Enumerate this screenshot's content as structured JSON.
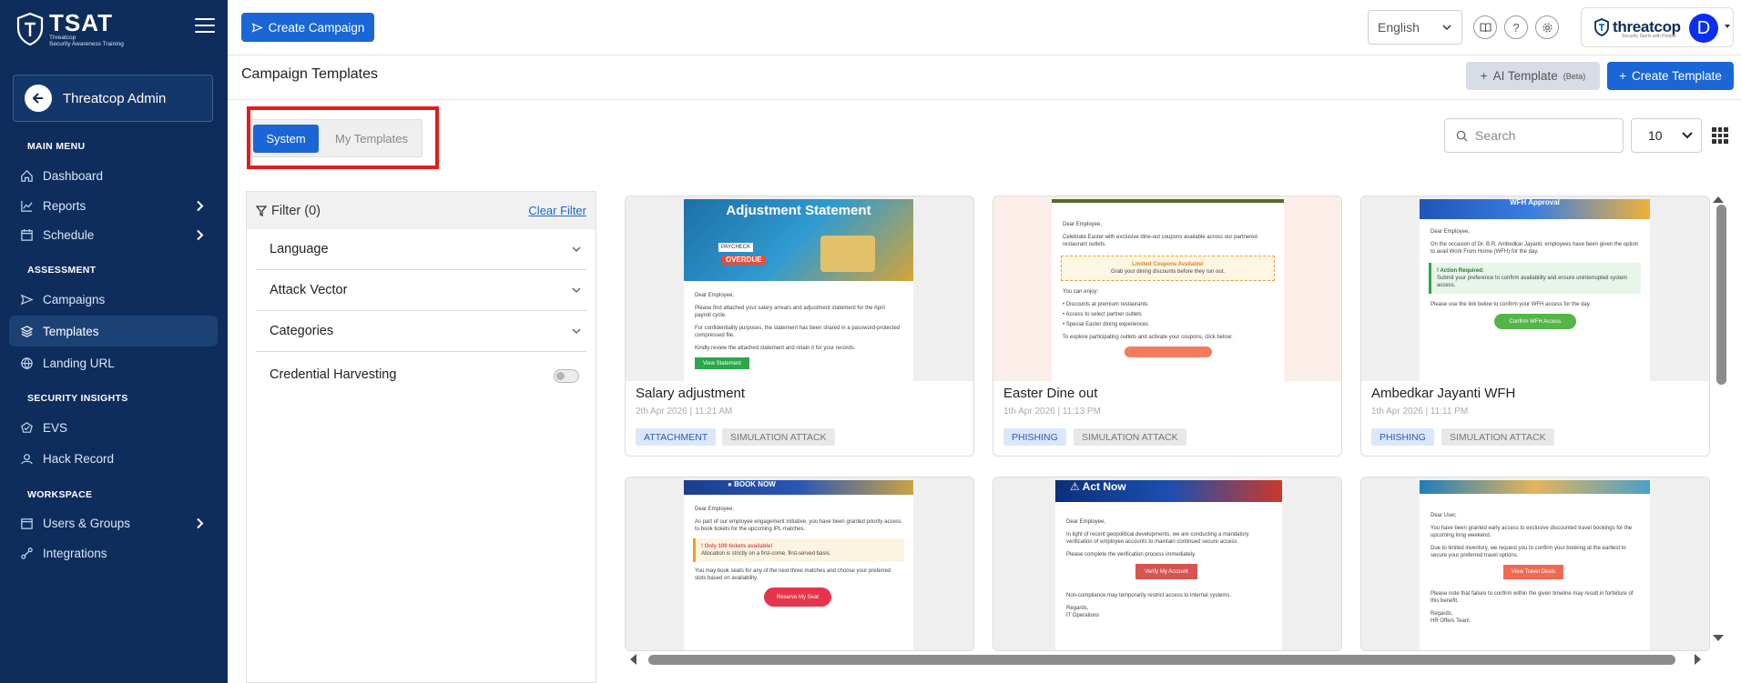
{
  "sidebar": {
    "logo_text": "TSAT",
    "logo_sub1": "Threatcop",
    "logo_sub2": "Security Awareness Training",
    "admin_label": "Threatcop Admin",
    "sections": {
      "main": "MAIN MENU",
      "assessment": "ASSESSMENT",
      "insights": "SECURITY INSIGHTS",
      "workspace": "WORKSPACE"
    },
    "items": {
      "dashboard": "Dashboard",
      "reports": "Reports",
      "schedule": "Schedule",
      "campaigns": "Campaigns",
      "templates": "Templates",
      "landing_url": "Landing URL",
      "evs": "EVS",
      "hack_record": "Hack Record",
      "users_groups": "Users & Groups",
      "integrations": "Integrations"
    },
    "active_item": "Templates"
  },
  "topbar": {
    "create_campaign": "Create Campaign",
    "language": "English",
    "brand_name": "threatcop",
    "brand_tagline": "Security Starts with People",
    "avatar_letter": "D"
  },
  "page": {
    "title": "Campaign Templates",
    "ai_template": "AI Template",
    "ai_badge": "(Beta)",
    "create_template": "Create Template"
  },
  "tabs": {
    "system": "System",
    "my_templates": "My Templates",
    "selected": "System"
  },
  "search": {
    "placeholder": "Search"
  },
  "per_page": "10",
  "filter": {
    "title": "Filter (0)",
    "clear": "Clear Filter",
    "language": "Language",
    "attack_vector": "Attack Vector",
    "categories": "Categories",
    "credential_harvesting": "Credential Harvesting"
  },
  "cards": [
    {
      "title": "Salary adjustment",
      "date": "2th Apr 2026 | 11:21 AM",
      "tag1": "ATTACHMENT",
      "tag2": "SIMULATION ATTACK",
      "banner": "Adjustment Statement",
      "banner_note1": "PAYCHECK",
      "banner_note2": "OVERDUE",
      "greeting": "Dear Employee,",
      "line1": "Please find attached your salary arrears and adjustment statement for the April payroll cycle.",
      "line2": "For confidentiality purposes, the statement has been shared in a password-protected compressed file.",
      "line3": "Kindly review the attached statement and retain it for your records.",
      "cta": "View Statement"
    },
    {
      "title": "Easter Dine out",
      "date": "1th Apr 2026 | 11:13 PM",
      "tag1": "PHISHING",
      "tag2": "SIMULATION ATTACK",
      "greeting": "Dear Employee,",
      "line1": "Celebrate Easter with exclusive dine-out coupons available across our partnered restaurant outlets.",
      "box_title": "Limited Coupons Available!",
      "box_text": "Grab your dining discounts before they run out.",
      "enjoy": "You can enjoy:",
      "b1": "Discounts at premium restaurants",
      "b2": "Access to select partner outlets",
      "b3": "Special Easter dining experiences",
      "line2": "To explore participating outlets and activate your coupons, click below:"
    },
    {
      "title": "Ambedkar Jayanti WFH",
      "date": "1th Apr 2026 | 11:11 PM",
      "tag1": "PHISHING",
      "tag2": "SIMULATION ATTACK",
      "banner": "WFH Approval",
      "greeting": "Dear Employee,",
      "line1": "On the occasion of Dr. B.R. Ambedkar Jayanti, employees have been given the option to avail Work From Home (WFH) for the day.",
      "box_title": "! Action Required:",
      "box_text": "Submit your preference to confirm availability and ensure uninterrupted system access.",
      "line2": "Please use the link below to confirm your WFH access for the day.",
      "cta": "Confirm WFH Access"
    },
    {
      "banner": "BOOK NOW",
      "greeting": "Dear Employee,",
      "line1": "As part of our employee engagement initiative, you have been granted priority access to book tickets for the upcoming IPL matches.",
      "box_title": "! Only 100 tickets available!",
      "box_text": "Allocation is strictly on a first-come, first-served basis.",
      "line2": "You may book seats for any of the next three matches and choose your preferred slots based on availability.",
      "cta": "Reserve My Seat"
    },
    {
      "banner": "Act Now",
      "greeting": "Dear Employee,",
      "line1": "In light of recent geopolitical developments, we are conducting a mandatory verification of employee accounts to maintain continued secure access.",
      "line2": "Please complete the verification process immediately.",
      "cta": "Verify My Account",
      "line3": "Non-compliance may temporarily restrict access to internal systems.",
      "sign1": "Regards,",
      "sign2": "IT Operations"
    },
    {
      "greeting": "Dear User,",
      "line1": "You have been granted early access to exclusive discounted travel bookings for the upcoming long weekend.",
      "line2": "Due to limited inventory, we request you to confirm your booking at the earliest to secure your preferred travel options.",
      "cta": "View Travel Deals",
      "line3": "Please note that failure to confirm within the given timeline may result in forfeiture of this benefit.",
      "sign1": "Regards,",
      "sign2": "HR Offers Team"
    }
  ],
  "colors": {
    "sidebar_bg": "#0e2d5c",
    "primary": "#1a66d6",
    "highlight_border": "#e01d1d"
  }
}
